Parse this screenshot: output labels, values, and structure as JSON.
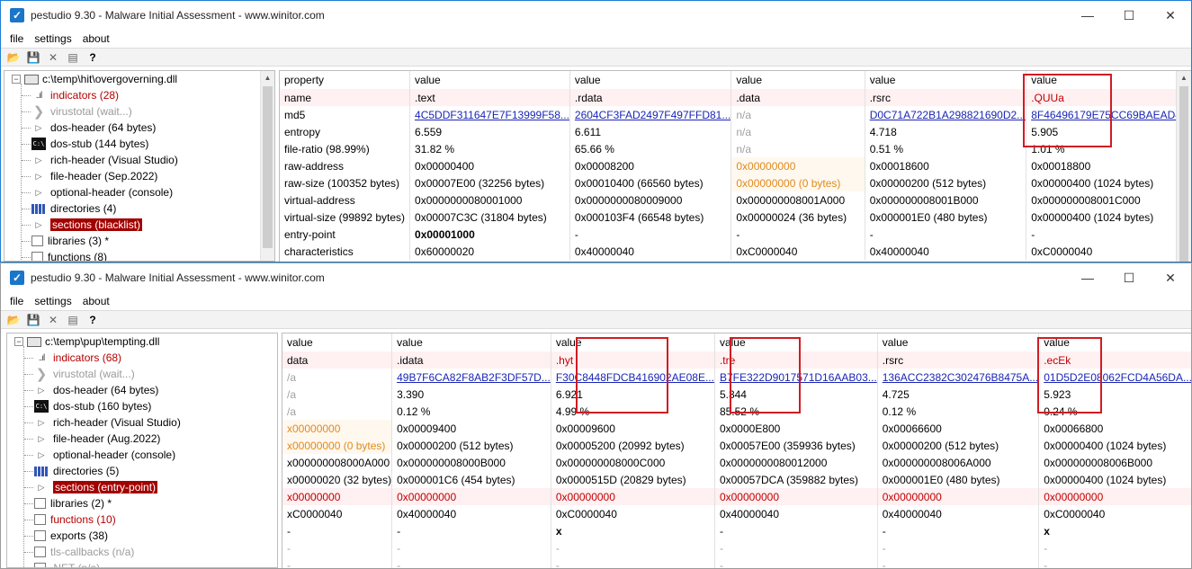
{
  "top": {
    "title": "pestudio 9.30 - Malware Initial Assessment - www.winitor.com",
    "menu": [
      "file",
      "settings",
      "about"
    ],
    "tree_root": "c:\\temp\\hit\\overgoverning.dll",
    "tree": [
      {
        "icon": "bars",
        "label": "indicators (28)",
        "style": "red"
      },
      {
        "icon": "vt",
        "label": "virustotal (wait...)",
        "style": "gray"
      },
      {
        "icon": "arrow",
        "label": "dos-header (64 bytes)",
        "style": ""
      },
      {
        "icon": "cmd",
        "label": "dos-stub (144 bytes)",
        "style": ""
      },
      {
        "icon": "arrow",
        "label": "rich-header (Visual Studio)",
        "style": ""
      },
      {
        "icon": "arrow",
        "label": "file-header (Sep.2022)",
        "style": ""
      },
      {
        "icon": "arrow",
        "label": "optional-header (console)",
        "style": ""
      },
      {
        "icon": "grid",
        "label": "directories (4)",
        "style": ""
      },
      {
        "icon": "arrow",
        "label": "sections (blacklist)",
        "style": "sel"
      },
      {
        "icon": "doc",
        "label": "libraries (3) *",
        "style": ""
      },
      {
        "icon": "doc",
        "label": "functions (8)",
        "style": ""
      }
    ],
    "columns": [
      "property",
      "value",
      "value",
      "value",
      "value",
      "value"
    ],
    "rows": [
      {
        "cells": [
          "name",
          ".text",
          ".rdata",
          ".data",
          ".rsrc",
          ".QUUa"
        ],
        "styles": [
          "",
          "",
          "",
          "",
          "",
          "red"
        ]
      },
      {
        "cells": [
          "md5",
          "4C5DDF311647E7F13999F58...",
          "2604CF3FAD2497F497FFD81...",
          "n/a",
          "D0C71A722B1A298821690D2...",
          "8F46496179E75CC69BAEAD4..."
        ],
        "styles": [
          "",
          "link",
          "link",
          "gray",
          "link",
          "link"
        ]
      },
      {
        "cells": [
          "entropy",
          "6.559",
          "6.611",
          "n/a",
          "4.718",
          "5.905"
        ],
        "styles": [
          "",
          "",
          "",
          "gray",
          "",
          ""
        ]
      },
      {
        "cells": [
          "file-ratio (98.99%)",
          "31.82 %",
          "65.66 %",
          "n/a",
          "0.51 %",
          "1.01 %"
        ],
        "styles": [
          "",
          "",
          "",
          "gray",
          "",
          ""
        ]
      },
      {
        "cells": [
          "raw-address",
          "0x00000400",
          "0x00008200",
          "0x00000000",
          "0x00018600",
          "0x00018800"
        ],
        "styles": [
          "",
          "",
          "",
          "orange",
          "",
          ""
        ]
      },
      {
        "cells": [
          "raw-size (100352 bytes)",
          "0x00007E00 (32256 bytes)",
          "0x00010400 (66560 bytes)",
          "0x00000000 (0 bytes)",
          "0x00000200 (512 bytes)",
          "0x00000400 (1024 bytes)"
        ],
        "styles": [
          "",
          "",
          "",
          "orange",
          "",
          ""
        ]
      },
      {
        "cells": [
          "virtual-address",
          "0x0000000080001000",
          "0x0000000080009000",
          "0x000000008001A000",
          "0x000000008001B000",
          "0x000000008001C000"
        ],
        "styles": [
          "",
          "",
          "",
          "",
          "",
          ""
        ]
      },
      {
        "cells": [
          "virtual-size (99892 bytes)",
          "0x00007C3C (31804 bytes)",
          "0x000103F4 (66548 bytes)",
          "0x00000024 (36 bytes)",
          "0x000001E0 (480 bytes)",
          "0x00000400 (1024 bytes)"
        ],
        "styles": [
          "",
          "",
          "",
          "",
          "",
          ""
        ]
      },
      {
        "cells": [
          "entry-point",
          "0x00001000",
          "-",
          "-",
          "-",
          "-"
        ],
        "styles": [
          "",
          "bold",
          "",
          "",
          "",
          ""
        ]
      },
      {
        "cells": [
          "characteristics",
          "0x60000020",
          "0x40000040",
          "0xC0000040",
          "0x40000040",
          "0xC0000040"
        ],
        "styles": [
          "",
          "",
          "",
          "",
          "",
          ""
        ]
      }
    ]
  },
  "bottom": {
    "title": "pestudio 9.30 - Malware Initial Assessment - www.winitor.com",
    "menu": [
      "file",
      "settings",
      "about"
    ],
    "tree_root": "c:\\temp\\pup\\tempting.dll",
    "tree": [
      {
        "icon": "bars",
        "label": "indicators (68)",
        "style": "red"
      },
      {
        "icon": "vt",
        "label": "virustotal (wait...)",
        "style": "gray"
      },
      {
        "icon": "arrow",
        "label": "dos-header (64 bytes)",
        "style": ""
      },
      {
        "icon": "cmd",
        "label": "dos-stub (160 bytes)",
        "style": ""
      },
      {
        "icon": "arrow",
        "label": "rich-header (Visual Studio)",
        "style": ""
      },
      {
        "icon": "arrow",
        "label": "file-header (Aug.2022)",
        "style": ""
      },
      {
        "icon": "arrow",
        "label": "optional-header (console)",
        "style": ""
      },
      {
        "icon": "grid",
        "label": "directories (5)",
        "style": ""
      },
      {
        "icon": "arrow",
        "label": "sections (entry-point)",
        "style": "sel"
      },
      {
        "icon": "doc",
        "label": "libraries (2) *",
        "style": ""
      },
      {
        "icon": "doc",
        "label": "functions (10)",
        "style": "red"
      },
      {
        "icon": "doc",
        "label": "exports (38)",
        "style": ""
      },
      {
        "icon": "doc",
        "label": "tls-callbacks (n/a)",
        "style": "gray"
      },
      {
        "icon": "doc",
        "label": ".NET (n/a)",
        "style": "gray"
      }
    ],
    "columns": [
      "value",
      "value",
      "value",
      "value",
      "value",
      "value"
    ],
    "rows": [
      {
        "cells": [
          "data",
          ".idata",
          ".hyt",
          ".tre",
          ".rsrc",
          ".ecEk"
        ],
        "styles": [
          "",
          "",
          "red",
          "red",
          "",
          "red"
        ]
      },
      {
        "cells": [
          "/a",
          "49B7F6CA82F8AB2F3DF57D...",
          "F30C8448FDCB416902AE08E...",
          "B7FE322D9017571D16AAB03...",
          "136ACC2382C302476B8475A...",
          "01D5D2E08062FCD4A56DA..."
        ],
        "styles": [
          "gray",
          "link",
          "link",
          "link",
          "link",
          "link"
        ]
      },
      {
        "cells": [
          "/a",
          "3.390",
          "6.921",
          "5.344",
          "4.725",
          "5.923"
        ],
        "styles": [
          "gray",
          "",
          "",
          "",
          "",
          ""
        ]
      },
      {
        "cells": [
          "/a",
          "0.12 %",
          "4.99 %",
          "85.52 %",
          "0.12 %",
          "0.24 %"
        ],
        "styles": [
          "gray",
          "",
          "",
          "",
          "",
          ""
        ]
      },
      {
        "cells": [
          "x00000000",
          "0x00009400",
          "0x00009600",
          "0x0000E800",
          "0x00066600",
          "0x00066800"
        ],
        "styles": [
          "orange",
          "",
          "",
          "",
          "",
          ""
        ]
      },
      {
        "cells": [
          "x00000000 (0 bytes)",
          "0x00000200 (512 bytes)",
          "0x00005200 (20992 bytes)",
          "0x00057E00 (359936 bytes)",
          "0x00000200 (512 bytes)",
          "0x00000400 (1024 bytes)"
        ],
        "styles": [
          "orange",
          "",
          "",
          "",
          "",
          ""
        ]
      },
      {
        "cells": [
          "x000000008000A000",
          "0x000000008000B000",
          "0x000000008000C000",
          "0x0000000080012000",
          "0x000000008006A000",
          "0x000000008006B000"
        ],
        "styles": [
          "",
          "",
          "",
          "",
          "",
          ""
        ]
      },
      {
        "cells": [
          "x00000020 (32 bytes)",
          "0x000001C6 (454 bytes)",
          "0x0000515D (20829 bytes)",
          "0x00057DCA (359882 bytes)",
          "0x000001E0 (480 bytes)",
          "0x00000400 (1024 bytes)"
        ],
        "styles": [
          "",
          "",
          "",
          "",
          "",
          ""
        ]
      },
      {
        "cells": [
          "x00000000",
          "0x00000000",
          "0x00000000",
          "0x00000000",
          "0x00000000",
          "0x00000000"
        ],
        "styles": [
          "red",
          "red",
          "red",
          "red",
          "red",
          "red"
        ],
        "pink": true
      },
      {
        "cells": [
          "xC0000040",
          "0x40000040",
          "0xC0000040",
          "0x40000040",
          "0x40000040",
          "0xC0000040"
        ],
        "styles": [
          "",
          "",
          "",
          "",
          "",
          ""
        ]
      },
      {
        "cells": [
          "-",
          "-",
          "x",
          "-",
          "-",
          "x"
        ],
        "styles": [
          "",
          "",
          "bold",
          "",
          "",
          "bold"
        ]
      },
      {
        "cells": [
          "-",
          "-",
          "-",
          "-",
          "-",
          "-"
        ],
        "styles": [
          "gray",
          "gray",
          "gray",
          "gray",
          "gray",
          "gray"
        ]
      },
      {
        "cells": [
          "-",
          "-",
          "-",
          "-",
          "-",
          "-"
        ],
        "styles": [
          "gray",
          "gray",
          "gray",
          "gray",
          "gray",
          "gray"
        ]
      }
    ]
  }
}
